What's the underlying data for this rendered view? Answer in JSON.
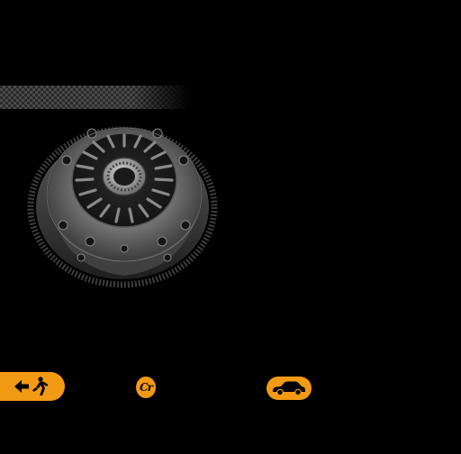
{
  "window": {
    "background": "#000000"
  },
  "hero": {
    "pattern": "checkered-band",
    "image": "twin-plate-clutch-assembly"
  },
  "toolbar": {
    "accent_color": "#f29a13",
    "exit_button": {
      "icon": "exit-arrow-running-person-icon"
    },
    "copyright_button": {
      "label": "Cr",
      "icon": "copyright-icon"
    },
    "car_button": {
      "icon": "car-icon"
    }
  }
}
